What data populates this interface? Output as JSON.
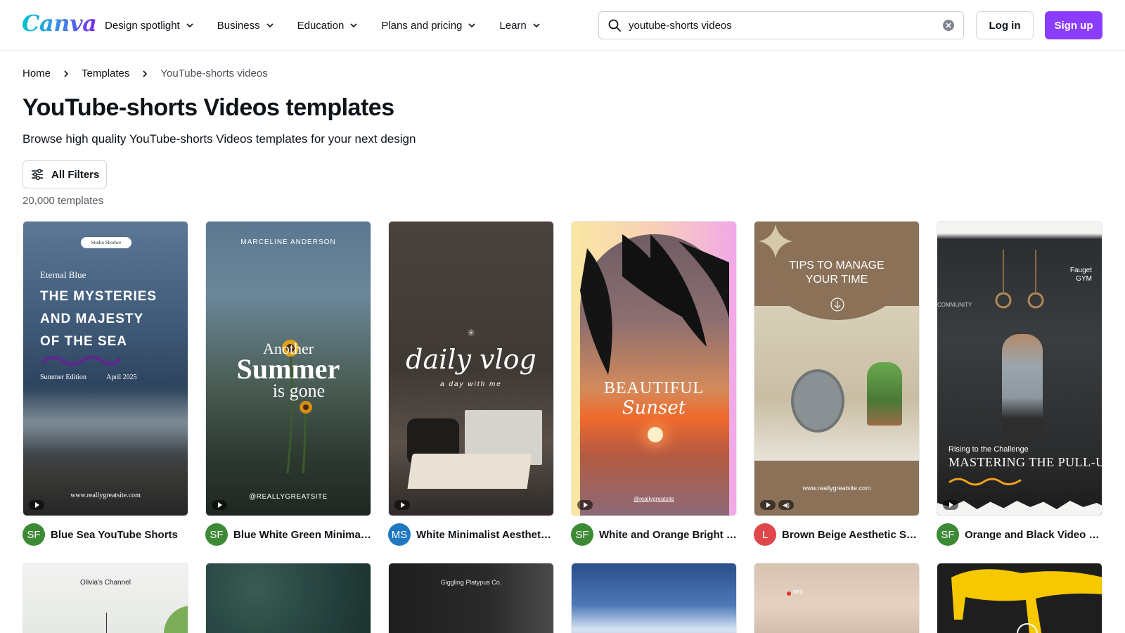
{
  "header": {
    "logo": "Canva",
    "nav": [
      {
        "label": "Design spotlight"
      },
      {
        "label": "Business"
      },
      {
        "label": "Education"
      },
      {
        "label": "Plans and pricing"
      },
      {
        "label": "Learn"
      }
    ],
    "search_value": "youtube-shorts videos",
    "login": "Log in",
    "signup": "Sign up"
  },
  "breadcrumb": [
    "Home",
    "Templates",
    "YouTube-shorts videos"
  ],
  "page": {
    "title": "YouTube-shorts Videos templates",
    "subtitle": "Browse high quality YouTube-shorts Videos templates for your next design",
    "filters": "All Filters",
    "count": "20,000 templates"
  },
  "colors": {
    "accent": "#8b3dff",
    "avatar_green": "#3d8a36",
    "avatar_blue": "#1f78c1",
    "avatar_red": "#e0474c"
  },
  "cards": [
    {
      "title": "Blue Sea YouTube Shorts",
      "avatar": "SF",
      "texts": {
        "badge": "Studio Shodwe",
        "kicker": "Eternal Blue",
        "line1": "THE MYSTERIES",
        "line2": "AND MAJESTY",
        "line3": "OF THE SEA",
        "edition": "Summer Edition",
        "date": "April 2025",
        "site": "www.reallygreatsite.com"
      }
    },
    {
      "title": "Blue White Green Minimalist Aesthetic",
      "avatar": "SF",
      "texts": {
        "name": "MARCELINE ANDERSON",
        "another": "Another",
        "summer": "Summer",
        "gone": "is gone",
        "handle": "@REALLYGREATSITE"
      }
    },
    {
      "title": "White Minimalist Aesthetic Daily Vlog",
      "avatar": "MS",
      "texts": {
        "daily": "daily vlog",
        "day": "a day with me"
      }
    },
    {
      "title": "White and Orange Bright aesthetic Sunset",
      "avatar": "SF",
      "texts": {
        "beautiful": "BEAUTIFUL",
        "sunset": "Sunset",
        "handle": "@reallygreatsite"
      }
    },
    {
      "title": "Brown Beige Aesthetic Simple Tips",
      "avatar": "L",
      "texts": {
        "tips1": "TIPS TO MANAGE",
        "tips2": "YOUR TIME",
        "site": "www.reallygreatsite.com"
      }
    },
    {
      "title": "Orange and Black Video Centered Gym",
      "avatar": "SF",
      "texts": {
        "gym1": "Fauget",
        "gym2": "GYM",
        "community": "COMMUNITY",
        "rising": "Rising to the Challenge",
        "master": "MASTERING THE PULL-UP"
      }
    }
  ],
  "row2": {
    "olivia": "Olivia's Channel",
    "giggling": "Giggling Platypus Co.",
    "rec": "REC"
  }
}
